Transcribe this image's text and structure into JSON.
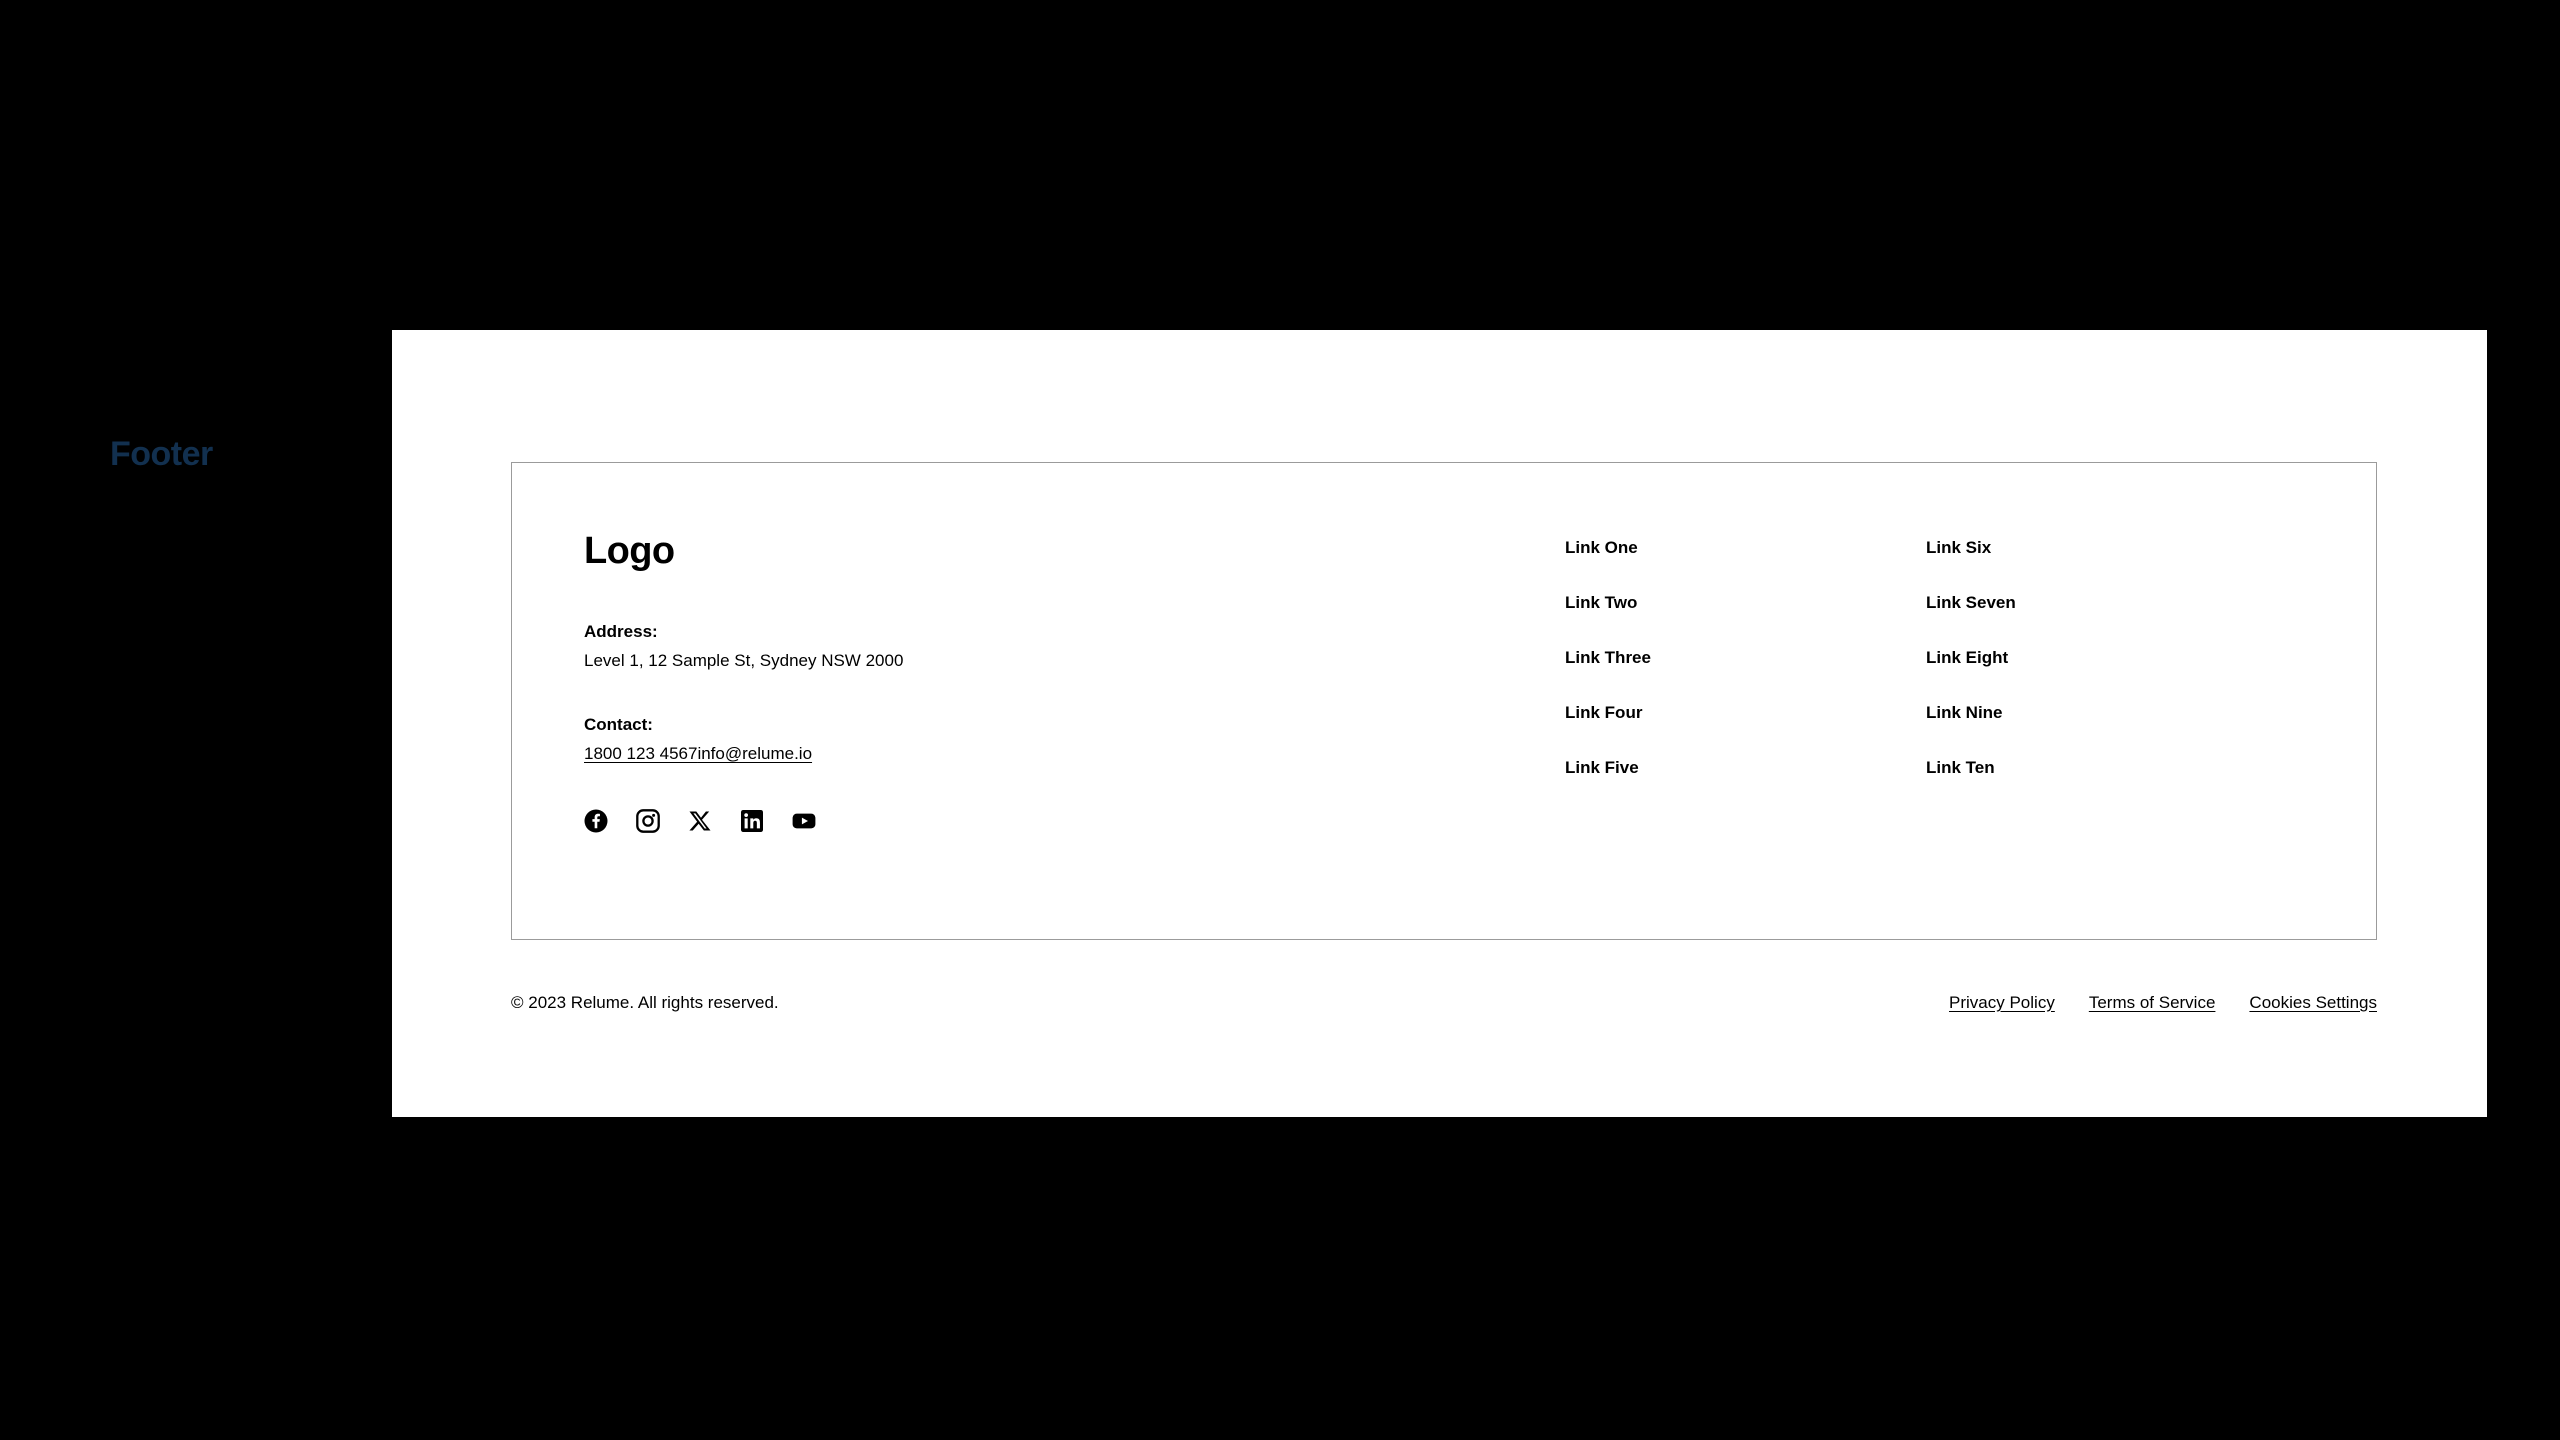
{
  "overlay": {
    "label": "Footer",
    "color": "#12304f"
  },
  "footer": {
    "brand": {
      "logo_text": "Logo",
      "address_label": "Address:",
      "address_value": "Level 1, 12 Sample St, Sydney NSW 2000",
      "contact_label": "Contact:",
      "phone": "1800 123 4567",
      "email": "info@relume.io"
    },
    "social": [
      {
        "name": "facebook-icon",
        "label": "Facebook"
      },
      {
        "name": "instagram-icon",
        "label": "Instagram"
      },
      {
        "name": "x-twitter-icon",
        "label": "X"
      },
      {
        "name": "linkedin-icon",
        "label": "LinkedIn"
      },
      {
        "name": "youtube-icon",
        "label": "YouTube"
      }
    ],
    "link_columns": [
      {
        "links": [
          {
            "label": "Link One"
          },
          {
            "label": "Link Two"
          },
          {
            "label": "Link Three"
          },
          {
            "label": "Link Four"
          },
          {
            "label": "Link Five"
          }
        ]
      },
      {
        "links": [
          {
            "label": "Link Six"
          },
          {
            "label": "Link Seven"
          },
          {
            "label": "Link Eight"
          },
          {
            "label": "Link Nine"
          },
          {
            "label": "Link Ten"
          }
        ]
      }
    ],
    "bottom": {
      "copyright": "© 2023 Relume. All rights reserved.",
      "legal": [
        {
          "label": "Privacy Policy"
        },
        {
          "label": "Terms of Service"
        },
        {
          "label": "Cookies Settings"
        }
      ]
    }
  },
  "colors": {
    "page_background": "#ffffff",
    "canvas_background": "#000000",
    "text": "#000000",
    "panel_border": "#9b9b9b",
    "overlay_text": "#12304f"
  }
}
